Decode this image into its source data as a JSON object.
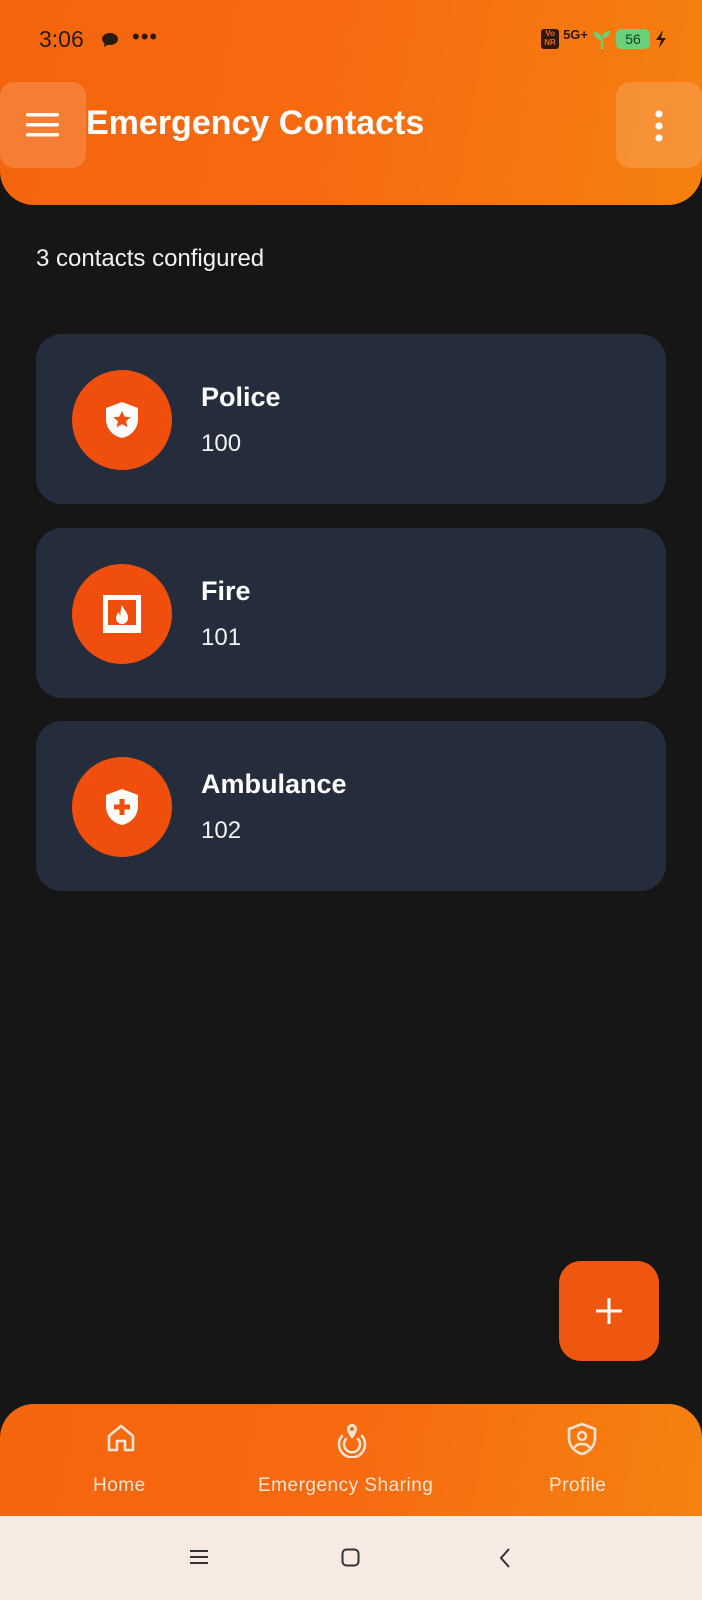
{
  "status_bar": {
    "time": "3:06",
    "dots": "•••",
    "network_badge": "Vo\nNR",
    "network": "5G+",
    "battery": "56"
  },
  "header": {
    "title": "Emergency Contacts",
    "menu_icon": "hamburger-menu-icon",
    "more_icon": "more-vertical-icon"
  },
  "summary": "3 contacts configured",
  "contacts": [
    {
      "name": "Police",
      "number": "100",
      "icon": "shield-star-icon"
    },
    {
      "name": "Fire",
      "number": "101",
      "icon": "fireplace-icon"
    },
    {
      "name": "Ambulance",
      "number": "102",
      "icon": "shield-medical-icon"
    }
  ],
  "fab": {
    "icon": "plus-icon"
  },
  "bottom_nav": {
    "items": [
      {
        "label": "Home",
        "icon": "home-icon"
      },
      {
        "label": "Emergency Sharing",
        "icon": "location-broadcast-icon"
      },
      {
        "label": "Profile",
        "icon": "shield-person-icon"
      }
    ]
  },
  "colors": {
    "accent": "#f4650e",
    "avatar": "#ef4e0d",
    "card": "#252d3c",
    "background": "#161616"
  }
}
